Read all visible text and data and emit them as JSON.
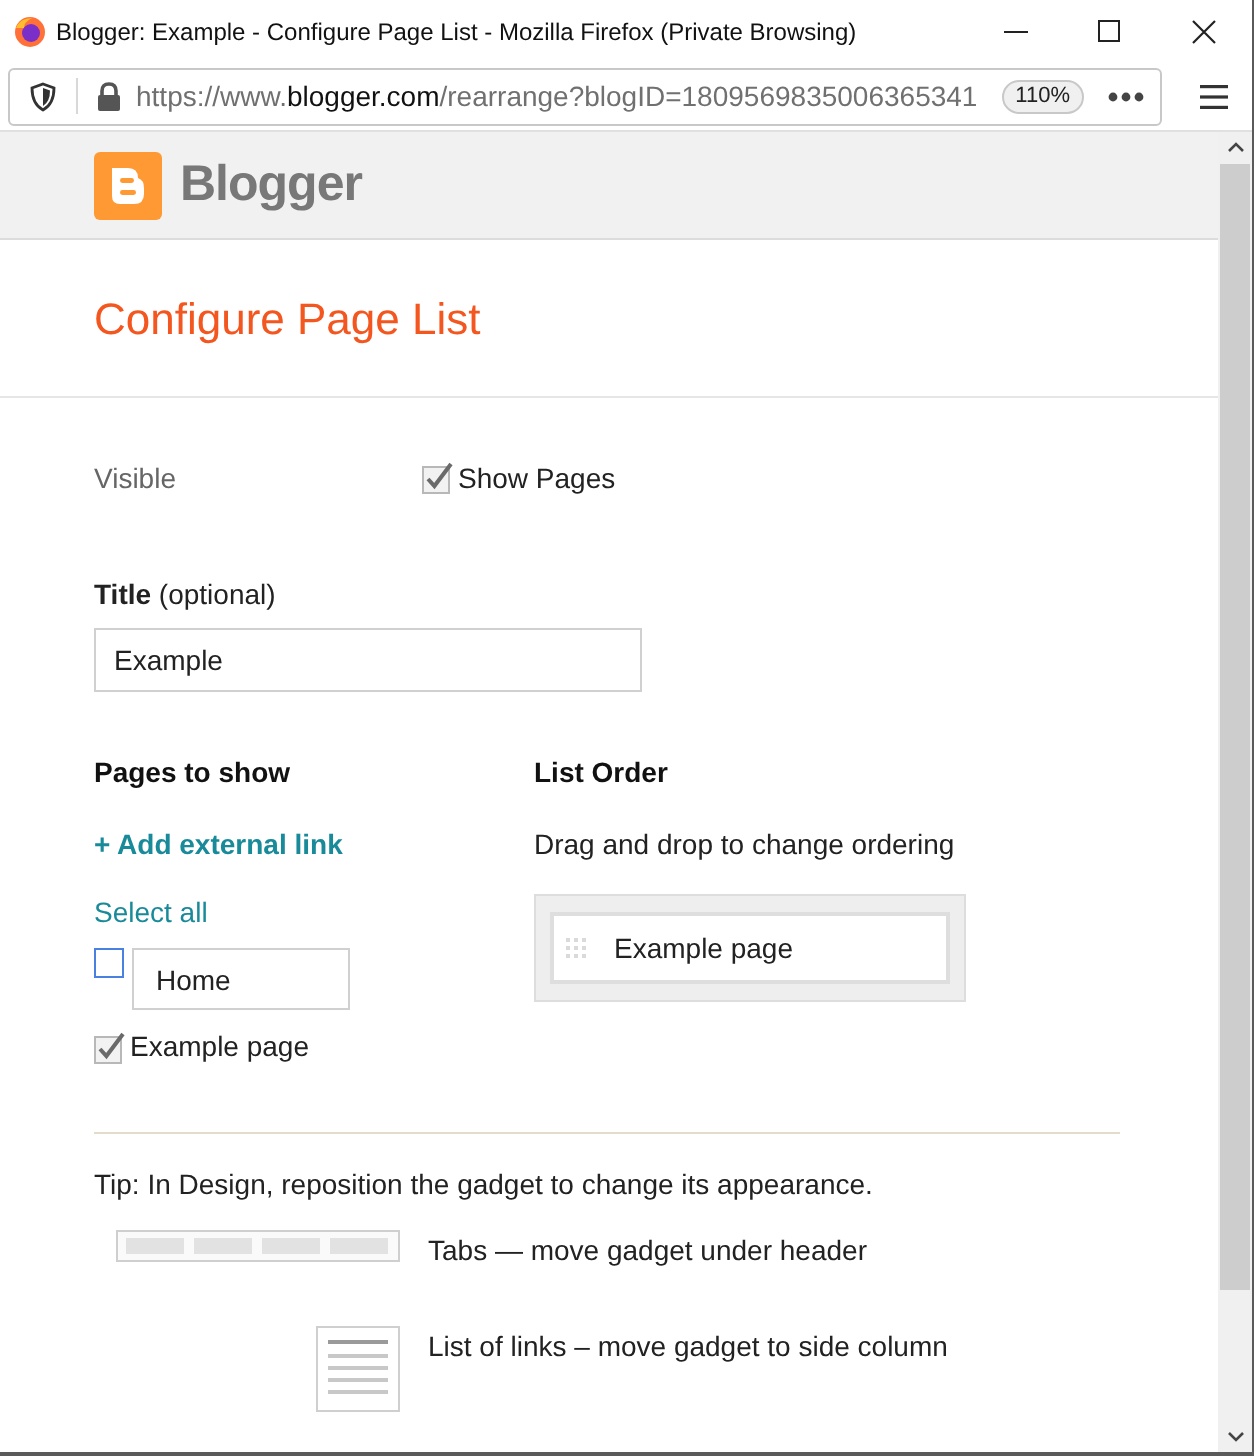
{
  "window": {
    "title": "Blogger: Example - Configure Page List - Mozilla Firefox (Private Browsing)"
  },
  "address_bar": {
    "url_scheme": "https://www.",
    "url_domain": "blogger.com",
    "url_path": "/rearrange?blogID=1809569835006365341",
    "zoom": "110%"
  },
  "header": {
    "logo_text": "Blogger"
  },
  "page_title": "Configure Page List",
  "visible": {
    "label": "Visible",
    "checkbox_label": "Show Pages",
    "checked": true
  },
  "title_field": {
    "label": "**Title** (optional)",
    "value": "Example"
  },
  "pages_to_show": {
    "heading": "Pages to show",
    "add_link": "+ Add external link",
    "select_all": "Select all",
    "pages": [
      {
        "kind": "editable",
        "value": "Home",
        "checked": false
      },
      {
        "kind": "fixed",
        "label": "Example page",
        "checked": true
      }
    ]
  },
  "list_order": {
    "heading": "List Order",
    "hint": "Drag and drop to change ordering",
    "items": [
      "Example page"
    ]
  },
  "tip": {
    "text": "Tip: In Design, reposition the gadget to change its appearance.",
    "layouts": [
      {
        "kind": "tabs",
        "text": "Tabs — move gadget under header"
      },
      {
        "kind": "list",
        "text": "List of links – move gadget to side column"
      }
    ]
  }
}
